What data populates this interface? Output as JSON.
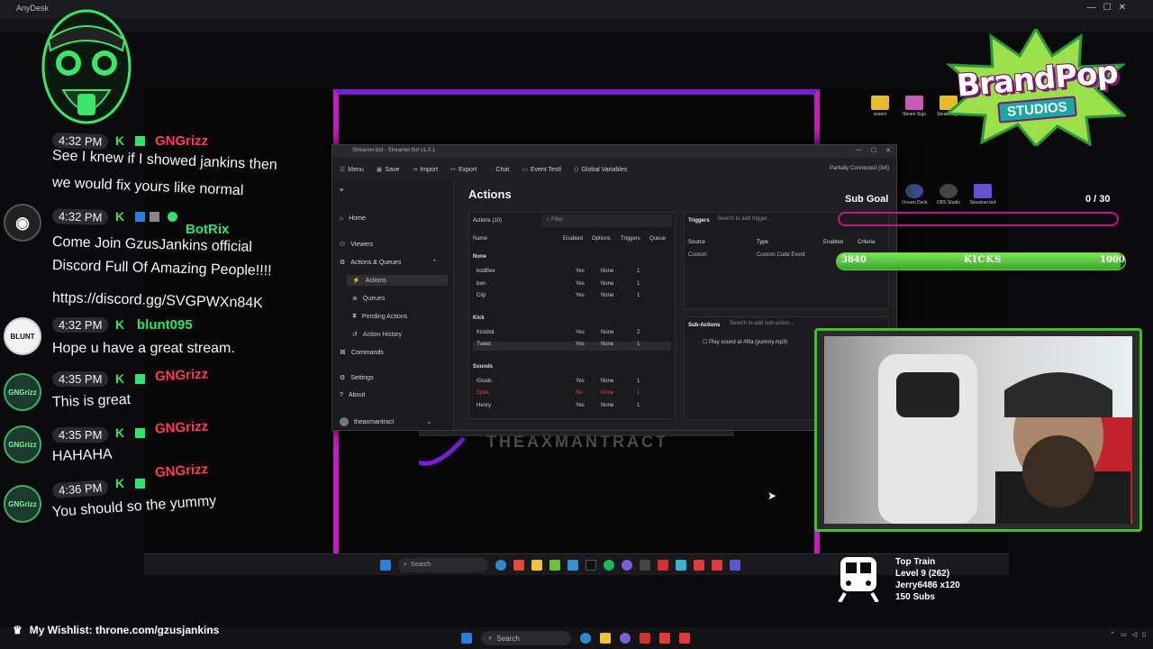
{
  "anydesk": {
    "title": "AnyDesk"
  },
  "remote_taskbar": {
    "search_placeholder": "Search"
  },
  "overlay_logo_text": "THEAXMANTRACT",
  "streamerbot": {
    "window_title": "Streamer.bot - Streamer.bot v1.0.1",
    "toolbar": [
      "Menu",
      "Save",
      "Import",
      "Export",
      "Chat",
      "Event Testl",
      "Global Variables"
    ],
    "status": "Partially Connected (3/4)",
    "nav": [
      "Home",
      "Viewers",
      "Actions & Queues",
      "Actions",
      "Queues",
      "Pending Actions",
      "Action History",
      "Commands",
      "Settings",
      "About"
    ],
    "profile": "theaxmantract",
    "heading": "Actions",
    "actions_count": "Actions (10)",
    "filter_placeholder": "Filter",
    "columns": [
      "Name",
      "Enabled",
      "Options",
      "Triggers",
      "Queue"
    ],
    "groups": [
      {
        "name": "None",
        "rows": [
          {
            "name": "bodBee",
            "enabled": "Yes",
            "options": "None",
            "triggers": "1"
          },
          {
            "name": "ban",
            "enabled": "Yes",
            "options": "None",
            "triggers": "1"
          },
          {
            "name": "Clip",
            "enabled": "Yes",
            "options": "None",
            "triggers": "1"
          }
        ]
      },
      {
        "name": "Kick",
        "rows": [
          {
            "name": "Kickbot",
            "enabled": "Yes",
            "options": "None",
            "triggers": "2"
          },
          {
            "name": "Tweet",
            "enabled": "Yes",
            "options": "None",
            "triggers": "1"
          }
        ]
      },
      {
        "name": "Sounds",
        "rows": [
          {
            "name": "iGoals",
            "enabled": "Yes",
            "options": "None",
            "triggers": "1"
          },
          {
            "name": "Spas",
            "enabled": "No",
            "options": "None",
            "triggers": "1"
          },
          {
            "name": "Henry",
            "enabled": "Yes",
            "options": "None",
            "triggers": "1"
          }
        ]
      }
    ],
    "triggers_label": "Triggers",
    "triggers_placeholder": "Search to add trigger...",
    "trigger_columns": [
      "Source",
      "Type",
      "Enabled",
      "Criteria"
    ],
    "trigger_row": {
      "source": "Custom",
      "type": "Custom Code Event"
    },
    "subactions_label": "Sub-Actions",
    "subactions_placeholder": "Search to add sub-action...",
    "subaction_item": "Play sound at #fifa (yummy.mp3)"
  },
  "desktop_icons": [
    "zesem",
    "Steam Sign",
    "Steam Sign",
    "Stream Deck",
    "OBS Studio",
    "Streamer.bot"
  ],
  "chat": [
    {
      "time": "4:32 PM",
      "user": "GNGrizz",
      "user_color": "#ff3d5a",
      "lines": [
        "See I knew if I showed jankins then",
        "we would fix yours like normal"
      ]
    },
    {
      "time": "4:32 PM",
      "user": "BotRix",
      "user_color": "#2fe36c",
      "lines": [
        "Come Join GzusJankins official",
        "Discord Full Of Amazing People!!!!",
        "https://discord.gg/SVGPWXn84K"
      ]
    },
    {
      "time": "4:32 PM",
      "user": "blunt095",
      "user_color": "#2fe36c",
      "avatar": "BLUNT",
      "lines": [
        "Hope u have a great stream."
      ]
    },
    {
      "time": "4:35 PM",
      "user": "GNGrizz",
      "user_color": "#ff3d5a",
      "avatar": "GNGrizz",
      "lines": [
        "This is great"
      ]
    },
    {
      "time": "4:35 PM",
      "user": "GNGrizz",
      "user_color": "#ff3d5a",
      "avatar": "GNGrizz",
      "lines": [
        "HAHAHA"
      ]
    },
    {
      "time": "4:36 PM",
      "user": "GNGrizz",
      "user_color": "#ff3d5a",
      "avatar": "GNGrizz",
      "lines": [
        "You should so the yummy"
      ]
    }
  ],
  "brandpop": {
    "line1": "BrandPop",
    "line2": "STUDIOS"
  },
  "subgoal": {
    "label": "Sub Goal",
    "count": "0 / 30"
  },
  "kicks": {
    "left": "3840",
    "label": "KICKS",
    "right": "1000",
    "progress": 0.0
  },
  "top_train": {
    "title": "Top Train",
    "level": "Level 9 (262)",
    "user": "Jerry6486 x120",
    "subs": "150 Subs"
  },
  "wishlist": "My Wishlist: throne.com/gzusjankins",
  "bottom_taskbar": {
    "search_placeholder": "Search"
  },
  "colors": {
    "accent_green": "#3ec02a",
    "frame_purple": "#7b1fd6",
    "goal_pink": "#c2168c"
  }
}
